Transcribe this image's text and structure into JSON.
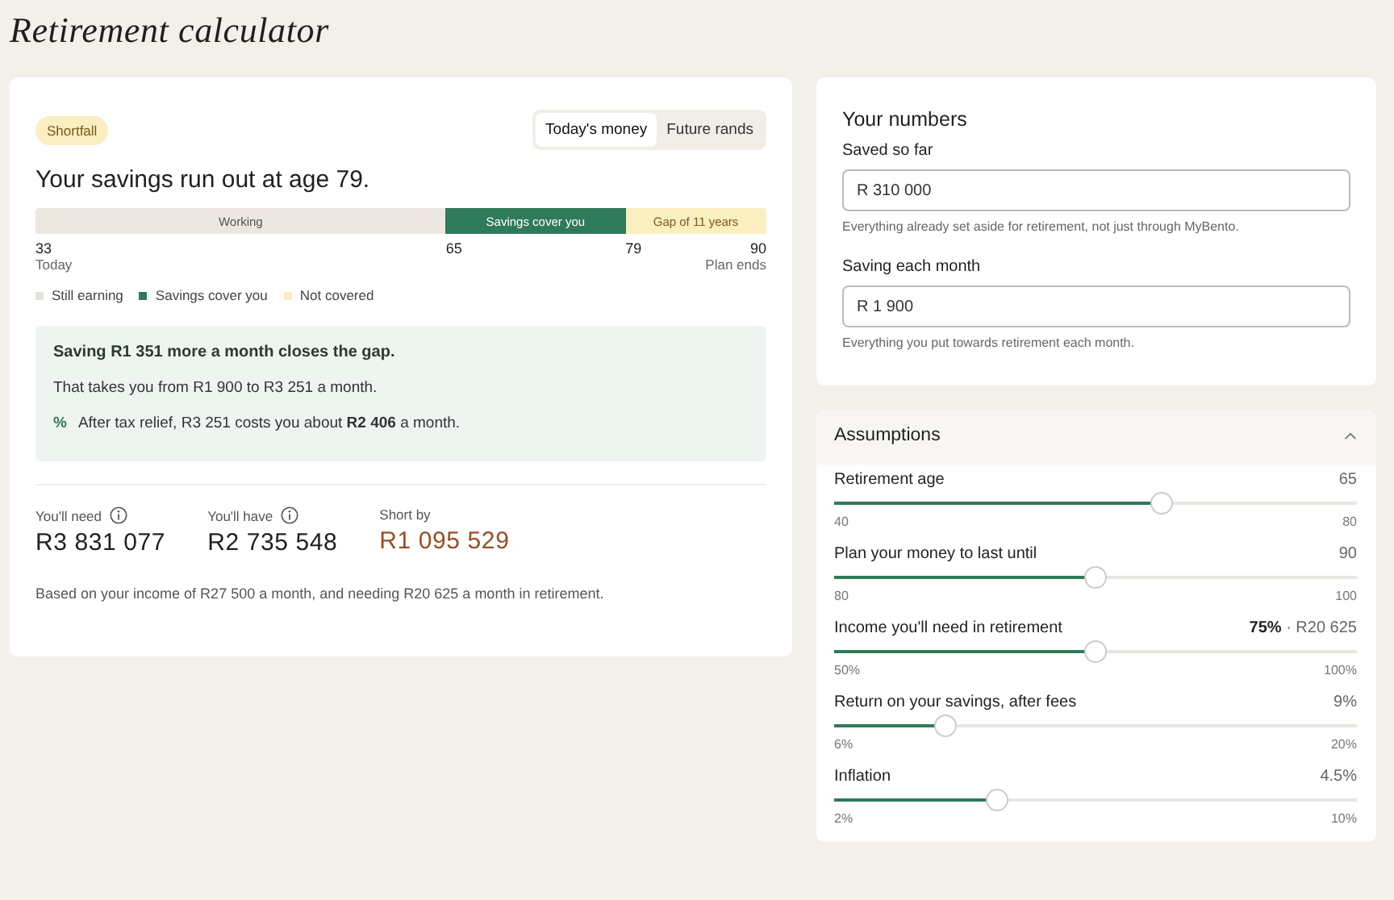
{
  "page_title": "Retirement calculator",
  "summary": {
    "badge": "Shortfall",
    "toggle": [
      {
        "label": "Today's money",
        "selected": true
      },
      {
        "label": "Future rands",
        "selected": false
      }
    ],
    "headline": "Your savings run out at age 79.",
    "timeline": [
      {
        "kind": "working",
        "label": "Working",
        "start": "33",
        "start_note": "Today"
      },
      {
        "kind": "covered",
        "label": "Savings cover you",
        "start": "65"
      },
      {
        "kind": "gap",
        "label": "Gap of 11 years",
        "start": "79",
        "end": "90",
        "end_note": "Plan ends"
      }
    ],
    "legend": [
      {
        "label": "Still earning",
        "color": "#e6e1da"
      },
      {
        "label": "Savings cover you",
        "color": "#2f7a5a"
      },
      {
        "label": "Not covered",
        "color": "#fbeec0"
      }
    ],
    "tip": {
      "title": "Saving R1 351 more a month closes the gap.",
      "line": "That takes you from R1 900 to R3 251 a month.",
      "icon_text": "%",
      "note": "After tax relief, R3 251 costs you about **R2 406** a month."
    },
    "stats": [
      {
        "label": "You'll need",
        "info": true,
        "value": "R3 831 077",
        "kind": "plain"
      },
      {
        "label": "You'll have",
        "info": true,
        "value": "R2 735 548",
        "kind": "plain"
      },
      {
        "label": "Short by",
        "info": false,
        "value": "R1 095 529",
        "kind": "warning"
      }
    ],
    "footnote": "Based on your income of R27 500 a month, and needing R20 625 a month in retirement."
  },
  "your_numbers": {
    "title": "Your numbers",
    "fields": [
      {
        "label": "Saved so far",
        "value": "R 310 000",
        "help": "Everything already set aside for retirement, not just through MyBento."
      },
      {
        "label": "Saving each month",
        "value": "R 1 900",
        "help": "Everything you put towards retirement each month."
      }
    ]
  },
  "assumptions": {
    "title": "Assumptions",
    "expanded": true,
    "sliders": [
      {
        "label": "Retirement age",
        "value": "65",
        "min": "40",
        "max": "80",
        "level": 0.625
      },
      {
        "label": "Plan your money to last until",
        "value": "90",
        "min": "80",
        "max": "100",
        "level": 0.5
      },
      {
        "label": "Income you'll need in retirement",
        "value": "**75%** · R20 625",
        "min": "50%",
        "max": "100%",
        "level": 0.5
      },
      {
        "label": "Return on your savings, after fees",
        "value": "9%",
        "min": "6%",
        "max": "20%",
        "level": 0.214
      },
      {
        "label": "Inflation",
        "value": "4.5%",
        "min": "2%",
        "max": "10%",
        "level": 0.3125
      }
    ]
  }
}
